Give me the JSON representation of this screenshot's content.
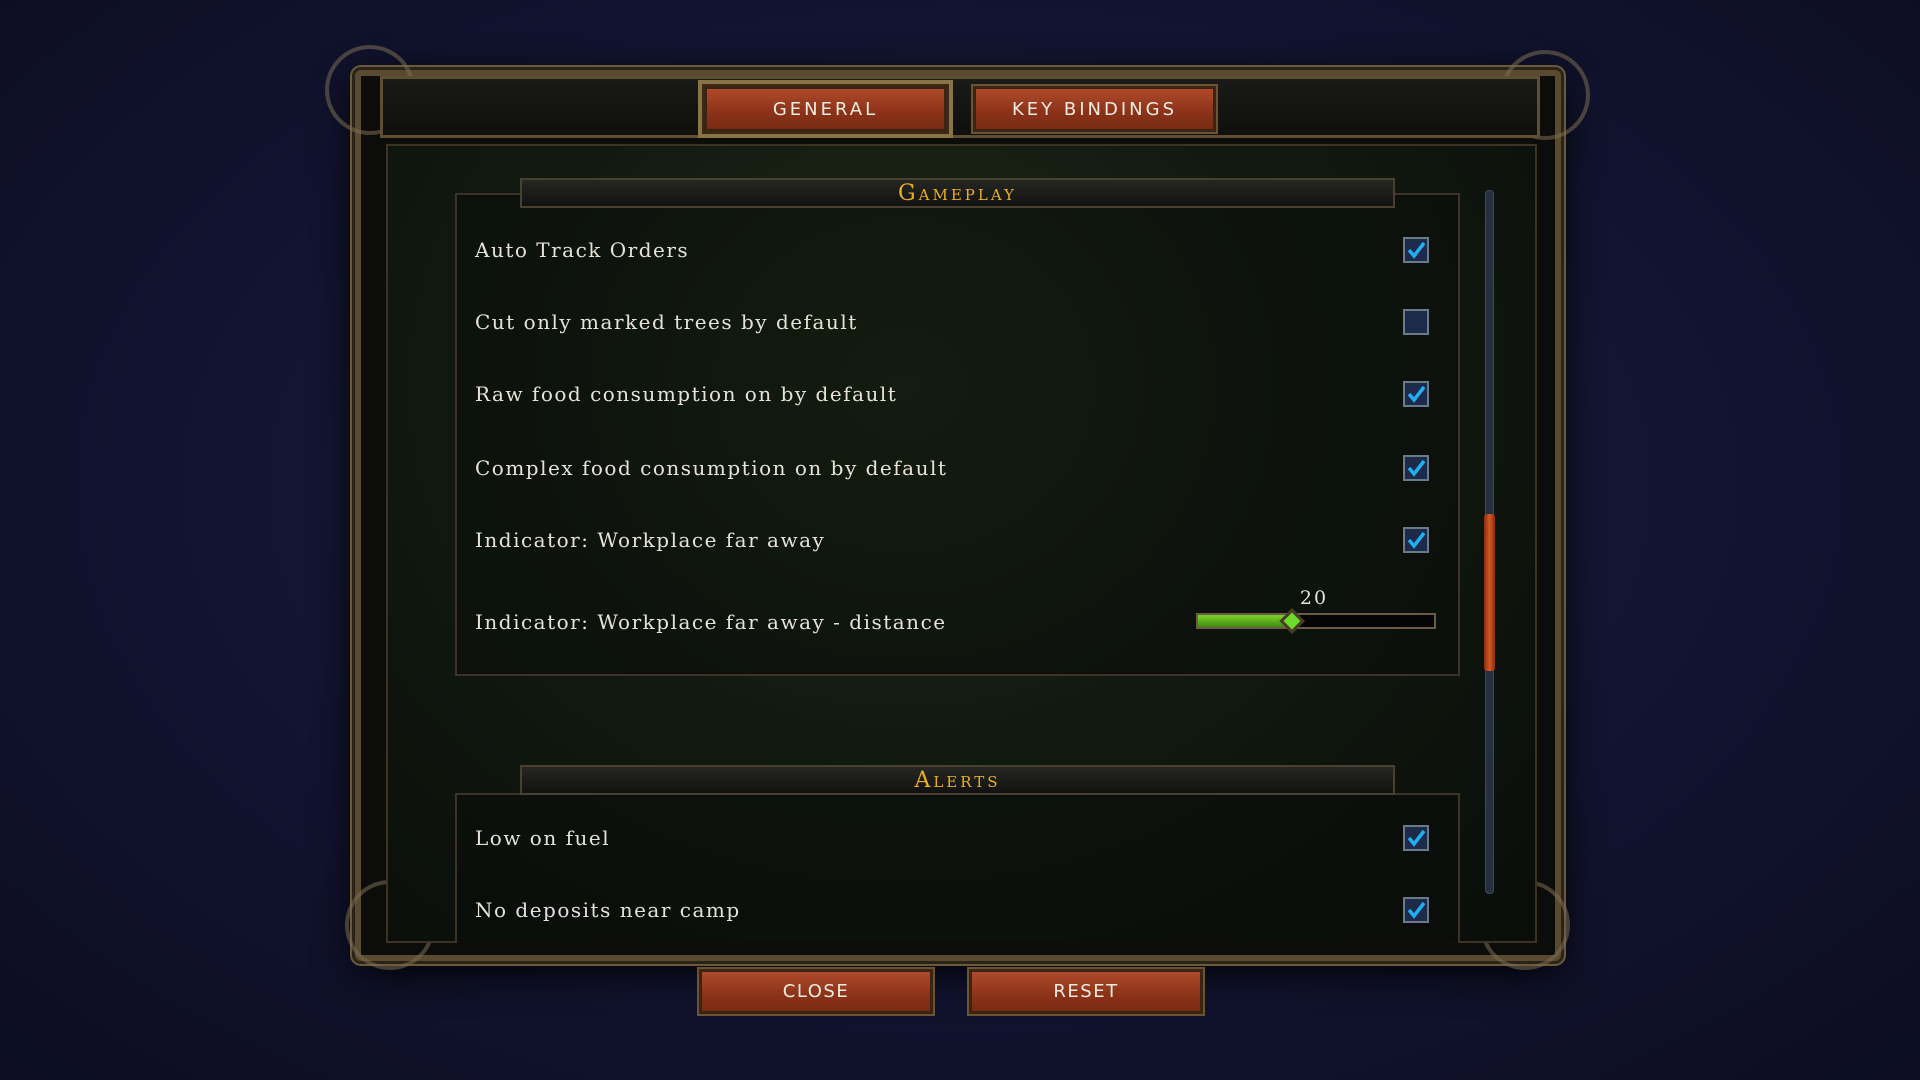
{
  "tabs": [
    {
      "label": "GENERAL",
      "active": true
    },
    {
      "label": "KEY BINDINGS",
      "active": false
    }
  ],
  "sections": {
    "gameplay": {
      "title": "Gameplay",
      "items": [
        {
          "label": "Auto Track Orders",
          "checked": true
        },
        {
          "label": "Cut only marked trees by default",
          "checked": false
        },
        {
          "label": "Raw food consumption on by default",
          "checked": true
        },
        {
          "label": "Complex food consumption on by default",
          "checked": true
        },
        {
          "label": "Indicator: Workplace far away",
          "checked": true
        }
      ],
      "slider": {
        "label": "Indicator: Workplace far away - distance",
        "value": "20",
        "fraction": 0.4
      }
    },
    "alerts": {
      "title": "Alerts",
      "items": [
        {
          "label": "Low on fuel",
          "checked": true
        },
        {
          "label": "No deposits near camp",
          "checked": true
        }
      ]
    }
  },
  "buttons": {
    "close": "CLOSE",
    "reset": "RESET"
  },
  "scroll": {
    "position_fraction": 0.46
  },
  "colors": {
    "accent_gold": "#e8b020",
    "button_red": "#8a3218",
    "check_blue": "#20b0f0",
    "slider_green": "#6cdc2a"
  }
}
